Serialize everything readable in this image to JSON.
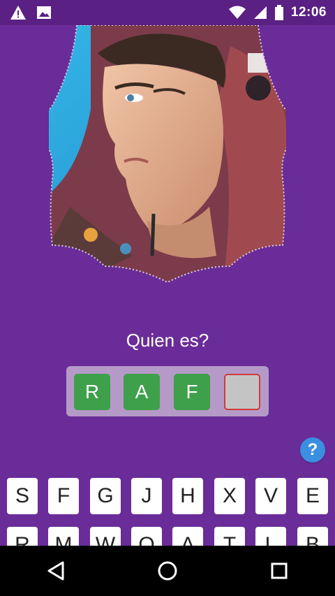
{
  "status_bar": {
    "time": "12:06",
    "left_icons": [
      "warning-icon",
      "image-icon"
    ],
    "right_icons": [
      "wifi-icon",
      "signal-icon",
      "battery-icon"
    ]
  },
  "game": {
    "question": "Quien es?",
    "answer_slots": [
      {
        "letter": "R",
        "state": "filled"
      },
      {
        "letter": "A",
        "state": "filled"
      },
      {
        "letter": "F",
        "state": "filled"
      },
      {
        "letter": "",
        "state": "empty"
      }
    ],
    "help_label": "?",
    "keyboard_row1": [
      "S",
      "F",
      "G",
      "J",
      "H",
      "X",
      "V",
      "E"
    ],
    "keyboard_row2": [
      "R",
      "M",
      "W",
      "O",
      "A",
      "T",
      "L",
      "B"
    ]
  },
  "colors": {
    "background": "#6a2c98",
    "slot_filled": "#3ea04a",
    "slot_empty_border": "#d0393a",
    "help_button": "#3a8fe0"
  },
  "nav_bar": {
    "buttons": [
      "back-icon",
      "home-icon",
      "recents-icon"
    ]
  }
}
